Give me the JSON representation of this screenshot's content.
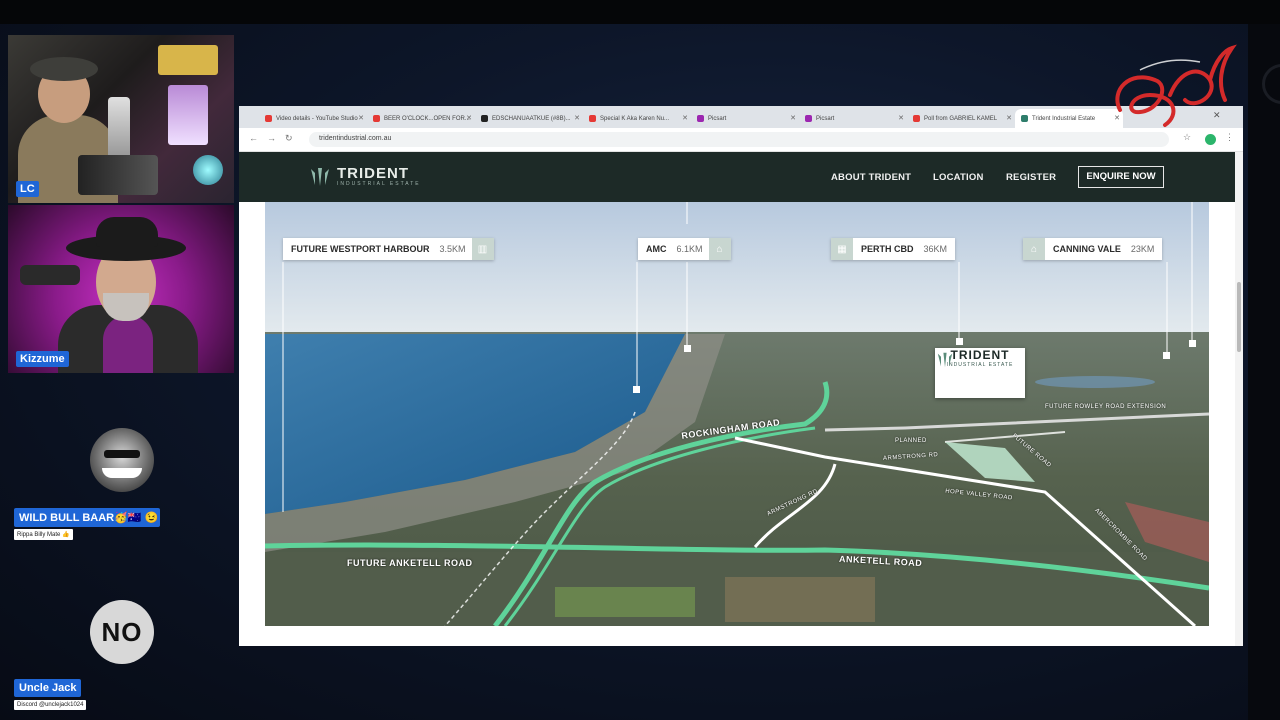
{
  "participants": [
    {
      "label": "LC"
    },
    {
      "label": "Kizzume"
    },
    {
      "name": "WILD BULL BAAR🥳🇦🇺 😉",
      "subtitle": "Rippa Billy Mate 👍"
    },
    {
      "name": "Uncle Jack",
      "subtitle": "Discord @unclejack1024",
      "avatar_text": "NO"
    }
  ],
  "browser": {
    "tabs": [
      {
        "label": "Video details - YouTube Studio",
        "color": "#e53935"
      },
      {
        "label": "BEER O'CLOCK...OPEN FOR...",
        "color": "#e53935"
      },
      {
        "label": "EDSCHANUAATKUE (#8B)...",
        "color": "#222222"
      },
      {
        "label": "Special K Aka Karen Nu...",
        "color": "#e53935"
      },
      {
        "label": "Picsart",
        "color": "#9c27b0"
      },
      {
        "label": "Picsart",
        "color": "#9c27b0"
      },
      {
        "label": "Poll from GABRIEL KAMEL",
        "color": "#e53935"
      },
      {
        "label": "Trident Industrial Estate",
        "color": "#2e7d6b"
      }
    ],
    "url": "tridentindustrial.com.au"
  },
  "site": {
    "logo_text": "TRIDENT",
    "logo_sub": "INDUSTRIAL ESTATE",
    "nav": {
      "about": "ABOUT TRIDENT",
      "location": "LOCATION",
      "register": "REGISTER",
      "enquire": "ENQUIRE NOW"
    },
    "callouts": [
      {
        "label": "FUTURE WESTPORT HARBOUR",
        "distance": "3.5KM",
        "icon": "harbour-icon"
      },
      {
        "label": "AMC",
        "distance": "6.1KM",
        "icon": "factory-icon"
      },
      {
        "label": "PERTH CBD",
        "distance": "36KM",
        "icon": "city-icon"
      },
      {
        "label": "CANNING VALE",
        "distance": "23KM",
        "icon": "building-icon"
      }
    ],
    "site_marker": {
      "title": "TRIDENT",
      "subtitle": "INDUSTRIAL ESTATE"
    },
    "roads": {
      "rockingham": "ROCKINGHAM ROAD",
      "anketell": "ANKETELL ROAD",
      "future_anketell": "FUTURE ANKETELL ROAD",
      "rowley": "FUTURE ROWLEY ROAD EXTENSION",
      "planned": "PLANNED",
      "armstrong": "ARMSTRONG RD",
      "hope_valley": "HOPE VALLEY ROAD",
      "abercrombie": "ABERCROMBIE ROAD",
      "future_road": "FUTURE ROAD"
    }
  },
  "colors": {
    "accent_green": "#5fd39a",
    "nav_bg": "#1d2a27",
    "badge_blue": "#1f66d6"
  }
}
